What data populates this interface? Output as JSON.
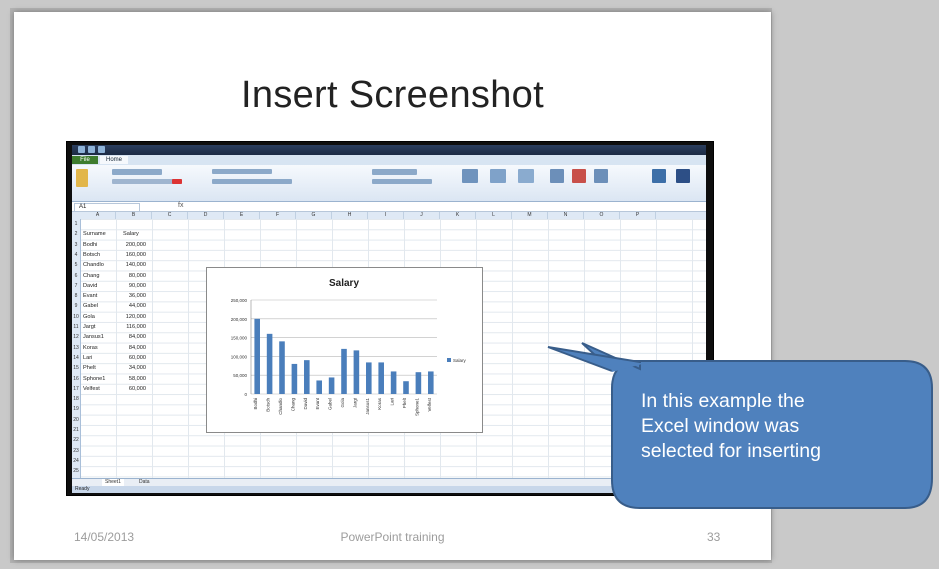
{
  "slide": {
    "title": "Insert Screenshot",
    "footer_date": "14/05/2013",
    "footer_center": "PowerPoint training",
    "footer_page": "33"
  },
  "excel": {
    "tabs": [
      "File",
      "Home"
    ],
    "name_box": "A1",
    "fx_icon": "fx-icon",
    "columns": [
      "A",
      "B",
      "C",
      "D",
      "E",
      "F",
      "G",
      "H",
      "I",
      "J",
      "K",
      "L",
      "M",
      "N",
      "O",
      "P"
    ],
    "header_row": {
      "name": "Surname",
      "value": "Salary"
    },
    "rows": [
      {
        "name": "Bodhi",
        "value": "200,000"
      },
      {
        "name": "Botsch",
        "value": "160,000"
      },
      {
        "name": "Chandlo",
        "value": "140,000"
      },
      {
        "name": "Chang",
        "value": "80,000"
      },
      {
        "name": "David",
        "value": "90,000"
      },
      {
        "name": "Evant",
        "value": "36,000"
      },
      {
        "name": "Gabel",
        "value": "44,000"
      },
      {
        "name": "Gola",
        "value": "120,000"
      },
      {
        "name": "Jargt",
        "value": "116,000"
      },
      {
        "name": "Jansus1",
        "value": "84,000"
      },
      {
        "name": "Koras",
        "value": "84,000"
      },
      {
        "name": "Lari",
        "value": "60,000"
      },
      {
        "name": "Phelt",
        "value": "34,000"
      },
      {
        "name": "Sphone1",
        "value": "58,000"
      },
      {
        "name": "Velfest",
        "value": "60,000"
      }
    ],
    "row_numbers": [
      "1",
      "2",
      "3",
      "4",
      "5",
      "6",
      "7",
      "8",
      "9",
      "10",
      "11",
      "12",
      "13",
      "14",
      "15",
      "16",
      "17",
      "18",
      "19",
      "20",
      "21",
      "22",
      "23",
      "24",
      "25"
    ],
    "sheet_tabs": [
      "Sheet1",
      "Data"
    ],
    "status": "Ready",
    "colors": {
      "ribbon": "#dbe6f3",
      "file_tab": "#3e7c2e",
      "bar": "#4a7ebb"
    }
  },
  "chart_data": {
    "type": "bar",
    "title": "Salary",
    "categories": [
      "Bodhi",
      "Botsch",
      "Chandlo",
      "Chang",
      "David",
      "Evant",
      "Gabel",
      "Gola",
      "Jargt",
      "Jansus1",
      "Koras",
      "Lari",
      "Phelt",
      "Sphone1",
      "Velfest"
    ],
    "series": [
      {
        "name": "Salary",
        "values": [
          200000,
          160000,
          140000,
          80000,
          90000,
          36000,
          44000,
          120000,
          116000,
          84000,
          84000,
          60000,
          34000,
          58000,
          60000
        ]
      }
    ],
    "yticks": [
      "0",
      "50,000",
      "100,000",
      "150,000",
      "200,000",
      "250,000"
    ],
    "ylim": [
      0,
      250000
    ],
    "legend": "right",
    "grid": true
  },
  "callout": {
    "text_lines": [
      "In this example the",
      "Excel window was",
      "selected for inserting"
    ],
    "color": "#4f81bd",
    "border": "#385d8a"
  }
}
